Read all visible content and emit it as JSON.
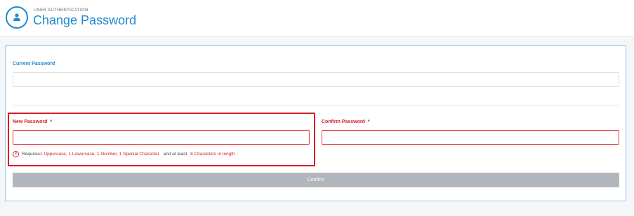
{
  "header": {
    "subtitle": "USER AUTHENTICATION",
    "title": "Change Password",
    "icon": "user-key-icon"
  },
  "form": {
    "current_password": {
      "label": "Current Password",
      "value": "",
      "placeholder": ""
    },
    "new_password": {
      "label": "New Password",
      "required_marker": "*",
      "value": "",
      "placeholder": ""
    },
    "confirm_password": {
      "label": "Confirm Password",
      "required_marker": "*",
      "value": "",
      "placeholder": ""
    },
    "hint": {
      "icon": "error-circle-icon",
      "prefix": "Requires",
      "requirements": "1 Uppercase, 1 Lowercase, 1 Number, 1 Special Character",
      "middle": "and at least",
      "length": "8 Characters in length"
    },
    "confirm_button": "Confirm"
  },
  "colors": {
    "accent": "#1f8ad0",
    "error": "#d31f26",
    "button_disabled": "#b1b6bc"
  }
}
